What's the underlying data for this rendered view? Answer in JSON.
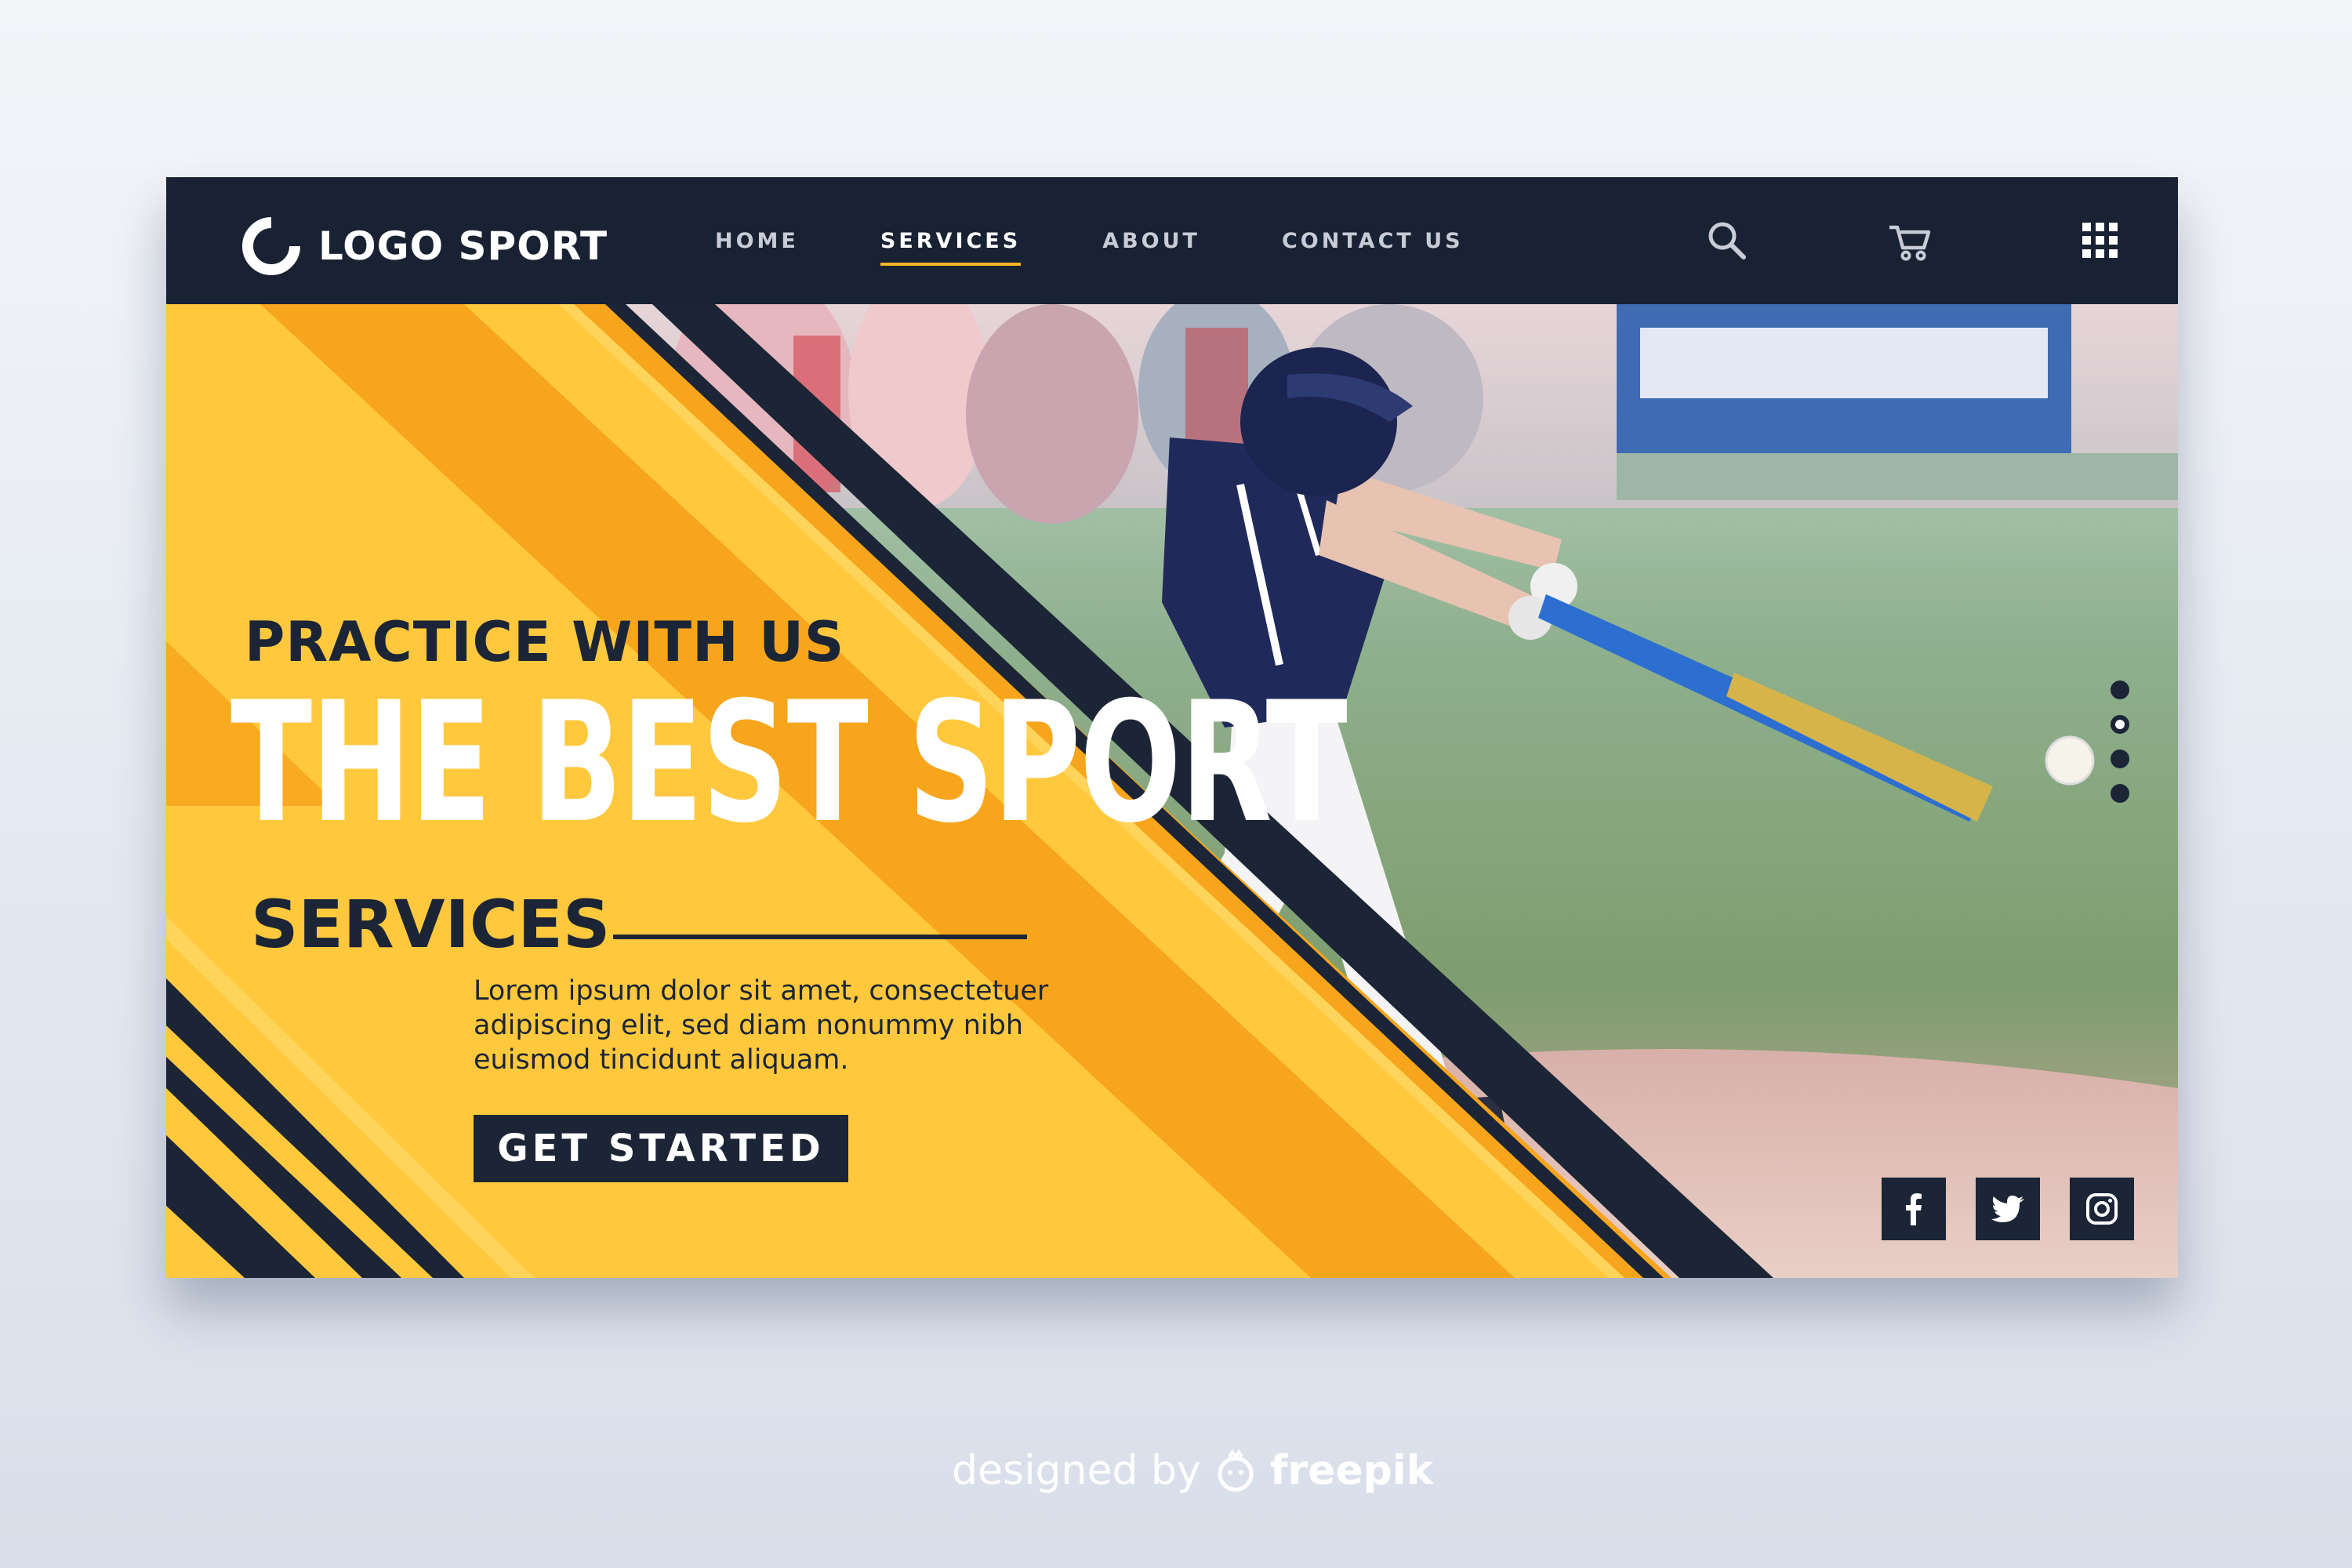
{
  "brand": {
    "logo_text": "LOGO SPORT"
  },
  "nav": {
    "items": [
      {
        "label": "HOME",
        "active": false
      },
      {
        "label": "SERVICES",
        "active": true
      },
      {
        "label": "ABOUT",
        "active": false
      },
      {
        "label": "CONTACT US",
        "active": false
      }
    ],
    "icons": [
      "search-icon",
      "cart-icon",
      "grid-menu-icon"
    ]
  },
  "hero": {
    "eyebrow": "PRACTICE WITH US",
    "headline": "THE BEST SPORT",
    "subhead": "SERVICES",
    "body": "Lorem ipsum dolor sit amet, consectetuer adipiscing elit, sed diam nonummy nibh euismod tincidunt aliquam.",
    "cta_label": "GET STARTED",
    "slides": {
      "count": 4,
      "active_index": 1
    }
  },
  "social": [
    "facebook-icon",
    "twitter-icon",
    "instagram-icon"
  ],
  "credit": {
    "prefix": "designed by",
    "brand": "freepik"
  },
  "colors": {
    "navy": "#1b2536",
    "nav_bg": "#192233",
    "yellow_light": "#ffc83d",
    "yellow_dark": "#f7a51c",
    "accent": "#f5b324"
  }
}
